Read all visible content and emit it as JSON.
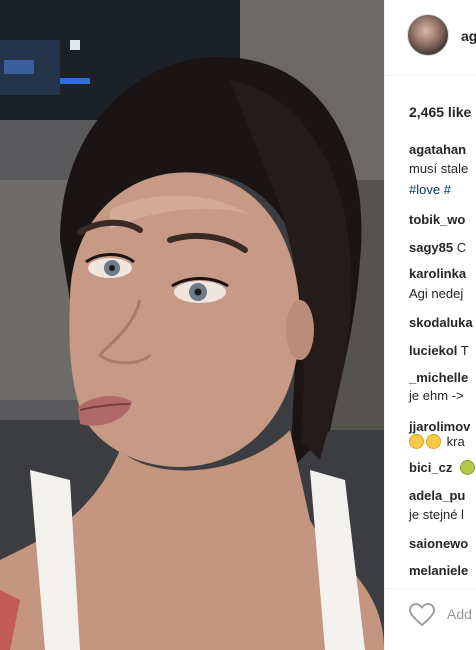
{
  "post": {
    "username": "ag",
    "likes": "2,465 like",
    "comments": [
      {
        "user": "agatahan",
        "text": ""
      },
      {
        "user": "",
        "text": "musí stale"
      },
      {
        "user": "",
        "text": "#love #"
      },
      {
        "user": "tobik_wo",
        "text": ""
      },
      {
        "user": "sagy85",
        "text": " C"
      },
      {
        "user": "karolinka",
        "text": ""
      },
      {
        "user": "",
        "text": "Agi nedej"
      },
      {
        "user": "skodaluka",
        "text": ""
      },
      {
        "user": "luciekol",
        "text": " T"
      },
      {
        "user": "_michelle",
        "text": ""
      },
      {
        "user": "",
        "text": "je ehm ->"
      },
      {
        "user": "jjarolimov",
        "text": ""
      },
      {
        "user": "",
        "text": " kra"
      },
      {
        "user": "bici_cz",
        "text": ""
      },
      {
        "user": "adela_pu",
        "text": ""
      },
      {
        "user": "",
        "text": "je stejné l"
      },
      {
        "user": "saionewo",
        "text": ""
      },
      {
        "user": "melaniele",
        "text": ""
      }
    ],
    "add_comment_placeholder": "Add",
    "icons": {
      "like": "heart-icon",
      "emoji": "emoji-icon"
    }
  }
}
